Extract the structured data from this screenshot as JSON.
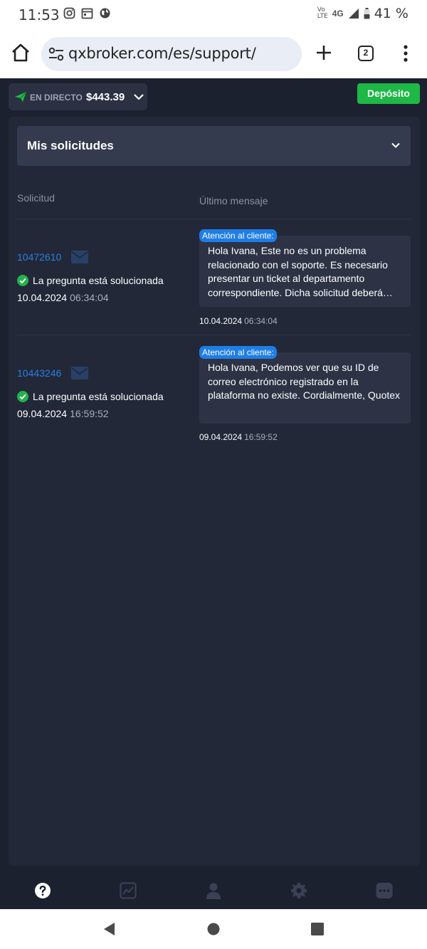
{
  "status_bar": {
    "time": "11:53",
    "network_top": "Vo",
    "network_bottom": "LTE",
    "network_type": "4G",
    "battery": "41 %"
  },
  "browser": {
    "url": "qxbroker.com/es/support/",
    "tab_count": "2"
  },
  "header": {
    "account_mode": "EN DIRECTO",
    "balance": "$443.39",
    "deposit_label": "Depósito"
  },
  "requests_section": {
    "title": "Mis solicitudes",
    "col_request": "Solicitud",
    "col_last_message": "Último mensaje",
    "rows": [
      {
        "id": "10472610",
        "status": "La pregunta está solucionada",
        "date": "10.04.2024",
        "time": "06:34:04",
        "message_author": "Atención al cliente:",
        "message_text": "Hola Ivana, Este no es un problema relacionado con el soporte. Es necesario presentar un ticket al departamento correspondiente. Dicha solicitud deberá…",
        "message_date": "10.04.2024",
        "message_time": "06:34:04"
      },
      {
        "id": "10443246",
        "status": "La pregunta está solucionada",
        "date": "09.04.2024",
        "time": "16:59:52",
        "message_author": "Atención al cliente:",
        "message_text": "Hola Ivana, Podemos ver que su ID de correo electrónico registrado en la plataforma no existe. Cordialmente, Quotex",
        "message_date": "09.04.2024",
        "message_time": "16:59:52"
      }
    ]
  },
  "bottom_nav": {
    "items": [
      "help-icon",
      "chart-icon",
      "user-icon",
      "gear-icon",
      "chat-icon"
    ]
  },
  "colors": {
    "background": "#1c2130",
    "panel": "#222838",
    "accent_link": "#2b7fe0",
    "deposit_green": "#1db845",
    "success_green": "#22b24c",
    "agent_tag_blue": "#1e7ee8"
  }
}
